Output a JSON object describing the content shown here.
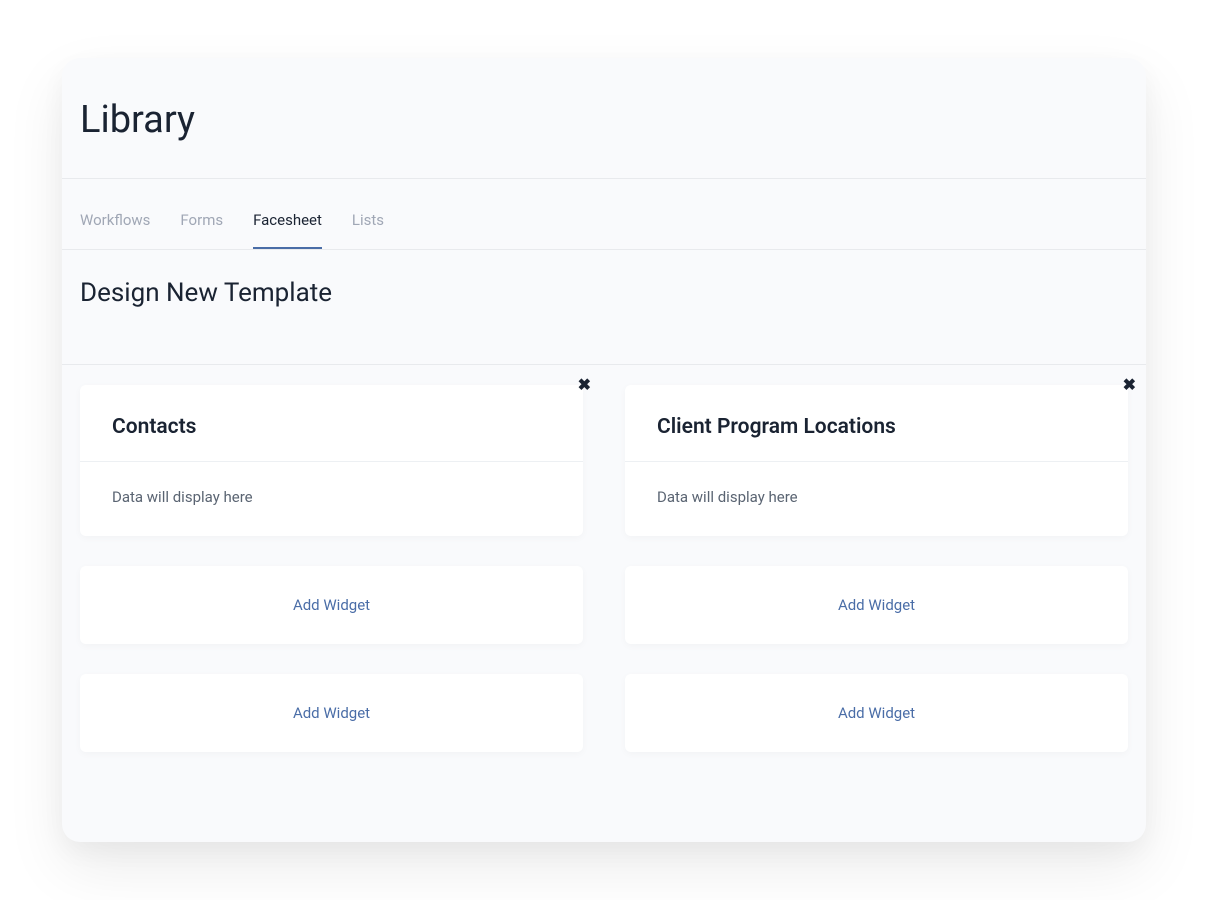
{
  "page": {
    "title": "Library"
  },
  "tabs": [
    {
      "label": "Workflows",
      "active": false
    },
    {
      "label": "Forms",
      "active": false
    },
    {
      "label": "Facesheet",
      "active": true
    },
    {
      "label": "Lists",
      "active": false
    }
  ],
  "section": {
    "title": "Design New Template"
  },
  "columns": {
    "left": {
      "widget": {
        "title": "Contacts",
        "body": "Data will display here"
      },
      "add_buttons": [
        "Add Widget",
        "Add Widget"
      ]
    },
    "right": {
      "widget": {
        "title": "Client Program Locations",
        "body": "Data will display here"
      },
      "add_buttons": [
        "Add Widget",
        "Add Widget"
      ]
    }
  }
}
